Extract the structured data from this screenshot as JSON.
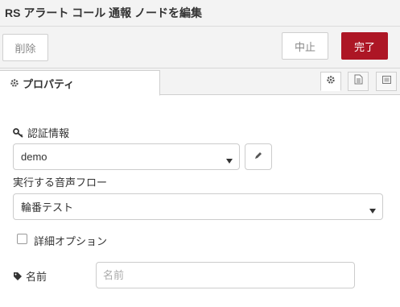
{
  "window": {
    "title": "RS アラート コール 通報 ノードを編集"
  },
  "toolbar": {
    "delete_label": "削除",
    "cancel_label": "中止",
    "done_label": "完了"
  },
  "tabs": [
    {
      "label": "プロパティ",
      "icon": "gear-icon"
    }
  ],
  "tab_icons": [
    "gear-icon",
    "document-icon",
    "frame-icon"
  ],
  "colors": {
    "done_button": "#ad1625",
    "header_bg": "#f3f3f3"
  },
  "form": {
    "credentials": {
      "label": "認証情報",
      "icon": "key-icon",
      "value": "demo"
    },
    "flow": {
      "label": "実行する音声フロー",
      "value": "輪番テスト"
    },
    "advanced": {
      "label": "詳細オプション",
      "checked": false
    },
    "name": {
      "label": "名前",
      "icon": "tag-icon",
      "placeholder": "名前",
      "value": ""
    }
  }
}
